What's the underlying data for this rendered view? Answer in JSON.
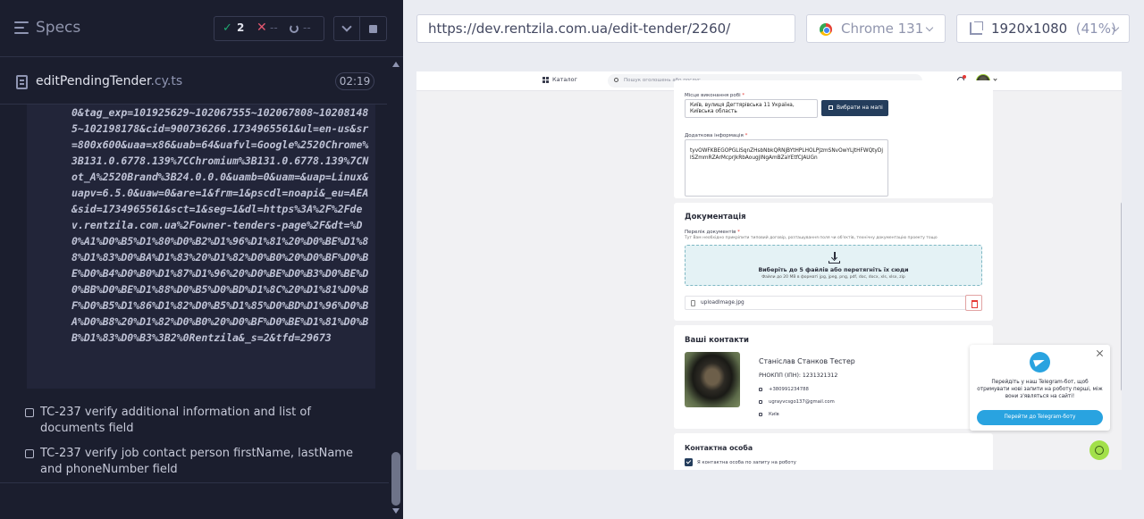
{
  "reporter": {
    "header": {
      "title": "Specs",
      "passed": "2",
      "failed": "--",
      "pending": "--"
    },
    "spec": {
      "name": "editPendingTender",
      "ext": ".cy.ts",
      "duration": "02:19"
    },
    "log_text": "0&tag_exp=101925629~102067555~102067808~102081485~102198178&cid=900736266.1734965561&ul=en-us&sr=800x600&uaa=x86&uab=64&uafvl=Google%2520Chrome%3B131.0.6778.139%7CChromium%3B131.0.6778.139%7CNot_A%2520Brand%3B24.0.0.0&uamb=0&uam=&uap=Linux&uapv=6.5.0&uaw=0&are=1&frm=1&pscdl=noapi&_eu=AEA&sid=1734965561&sct=1&seg=1&dl=https%3A%2F%2Fdev.rentzila.com.ua%2Fowner-tenders-page%2F&dt=%D0%A1%D0%B5%D1%80%D0%B2%D1%96%D1%81%20%D0%BE%D1%88%D1%83%D0%BA%D1%83%20%D1%82%D0%B0%20%D0%BF%D0%BE%D0%B4%D0%B0%D1%87%D1%96%20%D0%BE%D0%B3%D0%BE%D0%BB%D0%BE%D1%88%D0%B5%D0%BD%D1%8C%20%D1%81%D0%BF%D0%B5%D1%86%D1%82%D0%B5%D1%85%D0%BD%D1%96%D0%BA%D0%B8%20%D1%82%D0%B0%20%D0%BF%D0%BE%D1%81%D0%BB%D1%83%D0%B3%3B2%0Rentzila&_s=2&tfd=29673",
    "tests": [
      {
        "label": "TC-237 verify additional information and list of documents field"
      },
      {
        "label": "TC-237 verify job contact person firstName, lastName and phoneNumber field"
      }
    ]
  },
  "browser": {
    "url": "https://dev.rentzila.com.ua/edit-tender/2260/",
    "name": "Chrome 131",
    "viewport": "1920x1080",
    "zoom": "(41%)"
  },
  "app": {
    "header": {
      "catalog": "Каталог",
      "search_placeholder": "Пошук оголошень або послуг"
    },
    "location": {
      "label": "Місце виконання робі",
      "value": "Київ, вулиця Дегтярівська 11 Україна, Київська область",
      "map_button": "Вибрати на мапі"
    },
    "additional_info": {
      "label": "Додаткова інформація",
      "value": "tyvOWFKBEGOPGLiSqnZHsbNbkQRNjBYtHPLHOLPJzmSNvOwYLJtHFWQtyDjlSZmmRZArMcprJkRbAougjINgAmBZaYEtfCJAUGn"
    },
    "documents": {
      "title": "Документація",
      "label": "Перелік документів",
      "hint": "Тут Вам необхідно прикріпити типовий договір, розташування поля чи об'єктів, технічну документацію проекту тощо",
      "drop_title": "Виберіть до 5 файлів або перетягніть їх сюди",
      "drop_hint": "Файли до 20 МВ в форматі jpg, jpeg, png, pdf, doc, docx, xls, xlsx, zip",
      "file": "uploadImage.jpg"
    },
    "contacts": {
      "title": "Ваші контакти",
      "name": "Станіслав Станков Тестер",
      "rnokpp": "РНОКПП (ІПН): 1231321312",
      "phone": "+380991234788",
      "email": "ugrayvcsgo137@gmail.com",
      "city": "Київ"
    },
    "contact_person": {
      "title": "Контактна особа",
      "checkbox_label": "Я контактна особа по запиту на роботу"
    },
    "telegram": {
      "text": "Перейдіть у наш Telegram-бот, щоб отримувати нові запити на роботу перші, між вони з'являться на сайті!",
      "button": "Перейти до Telegram-боту"
    }
  },
  "colors": {
    "reporter_bg": "#1b1e2e",
    "pass": "#1fa971",
    "fail": "#e45770",
    "primary_button": "#243d5c",
    "telegram": "#29a3e0",
    "chat_fab": "#a2e04a"
  }
}
